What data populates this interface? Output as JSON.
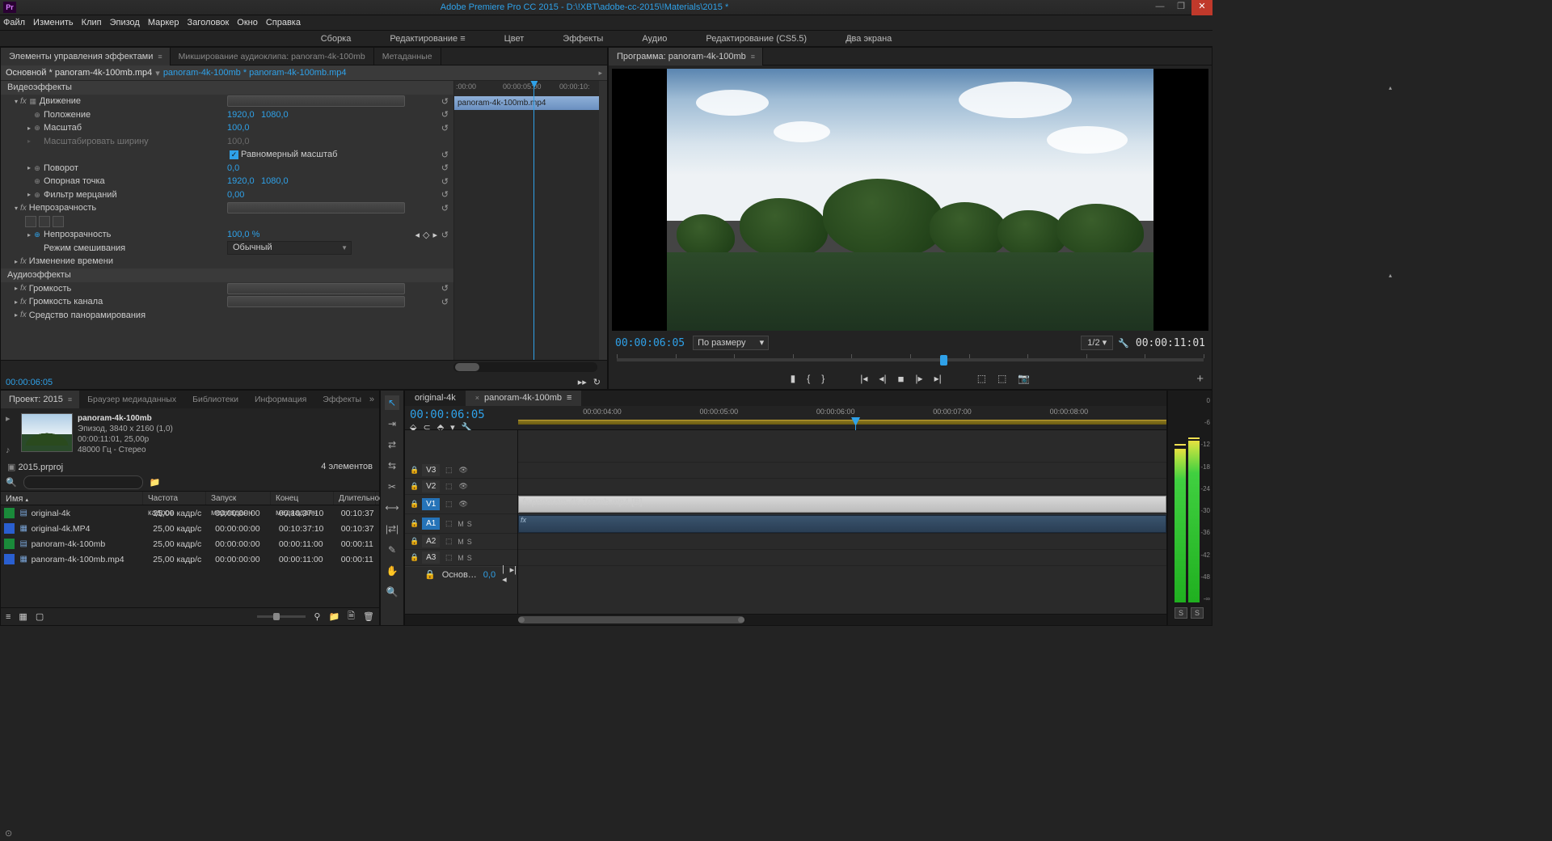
{
  "app": {
    "title": "Adobe Premiere Pro CC 2015 - D:\\!XBT\\adobe-cc-2015\\!Materials\\2015 *"
  },
  "menu": [
    "Файл",
    "Изменить",
    "Клип",
    "Эпизод",
    "Маркер",
    "Заголовок",
    "Окно",
    "Справка"
  ],
  "workspaces": {
    "items": [
      "Сборка",
      "Редактирование",
      "Цвет",
      "Эффекты",
      "Аудио",
      "Редактирование (CS5.5)",
      "Два экрана"
    ],
    "active": 1
  },
  "effectControls": {
    "tabs": [
      "Элементы управления эффектами",
      "Микширование аудиоклипа: panoram-4k-100mb",
      "Метаданные"
    ],
    "activeTab": 0,
    "source": {
      "primary": "Основной * panoram-4k-100mb.mp4",
      "link1": "panoram-4k-100mb",
      "link2": "panoram-4k-100mb.mp4"
    },
    "sections": {
      "videoHeader": "Видеоэффекты",
      "motion": "Движение",
      "position": {
        "label": "Положение",
        "x": "1920,0",
        "y": "1080,0"
      },
      "scale": {
        "label": "Масштаб",
        "val": "100,0"
      },
      "scaleWidth": {
        "label": "Масштабировать ширину",
        "val": "100,0"
      },
      "uniform": {
        "label": "Равномерный масштаб"
      },
      "rotation": {
        "label": "Поворот",
        "val": "0,0"
      },
      "anchor": {
        "label": "Опорная точка",
        "x": "1920,0",
        "y": "1080,0"
      },
      "flicker": {
        "label": "Фильтр мерцаний",
        "val": "0,00"
      },
      "opacity": "Непрозрачность",
      "opacityVal": {
        "label": "Непрозрачность",
        "val": "100,0 %"
      },
      "blend": {
        "label": "Режим смешивания",
        "val": "Обычный"
      },
      "timeRemap": "Изменение времени",
      "audioHeader": "Аудиоэффекты",
      "volume": "Громкость",
      "channelVolume": "Громкость канала",
      "panner": "Средство панорамирования"
    },
    "miniTimeline": {
      "ticks": [
        ":00:00",
        "00:00:05:00",
        "00:00:10:"
      ],
      "clipLabel": "panoram-4k-100mb.mp4",
      "playheadPct": 55
    },
    "footerTC": "00:00:06:05"
  },
  "program": {
    "title": "Программа: panoram-4k-100mb",
    "tcLeft": "00:00:06:05",
    "zoom": "По размеру кадра",
    "half": "1/2",
    "tcRight": "00:00:11:01",
    "playheadPct": 55
  },
  "project": {
    "tabs": [
      "Проект: 2015",
      "Браузер медиаданных",
      "Библиотеки",
      "Информация",
      "Эффекты"
    ],
    "activeTab": 0,
    "clip": {
      "name": "panoram-4k-100mb",
      "line1": "Эпизод, 3840 x 2160 (1,0)",
      "line2": "00:00:11:01, 25,00p",
      "line3": "48000 Гц - Стерео"
    },
    "path": "2015.prproj",
    "count": "4 элементов",
    "searchPlaceholder": "",
    "columns": [
      "Имя",
      "Частота кадров",
      "Запуск медиаданн",
      "Конец медиаданн",
      "Длительнос"
    ],
    "rows": [
      {
        "color": "green",
        "icon": "seq",
        "name": "original-4k",
        "fr": "25,00 кадр/с",
        "st": "00:00:00:00",
        "en": "00:10:37:10",
        "du": "00:10:37"
      },
      {
        "color": "blue",
        "icon": "clip",
        "name": "original-4k.MP4",
        "fr": "25,00 кадр/с",
        "st": "00:00:00:00",
        "en": "00:10:37:10",
        "du": "00:10:37"
      },
      {
        "color": "green",
        "icon": "seq",
        "name": "panoram-4k-100mb",
        "fr": "25,00 кадр/с",
        "st": "00:00:00:00",
        "en": "00:00:11:00",
        "du": "00:00:11"
      },
      {
        "color": "blue",
        "icon": "clip",
        "name": "panoram-4k-100mb.mp4",
        "fr": "25,00 кадр/с",
        "st": "00:00:00:00",
        "en": "00:00:11:00",
        "du": "00:00:11"
      }
    ]
  },
  "timeline": {
    "tabs": [
      {
        "name": "original-4k",
        "active": false
      },
      {
        "name": "panoram-4k-100mb",
        "active": true
      }
    ],
    "tc": "00:00:06:05",
    "ruler": [
      "00:00:04:00",
      "00:00:05:00",
      "00:00:06:00",
      "00:00:07:00",
      "00:00:08:00"
    ],
    "tracks": {
      "v3": "V3",
      "v2": "V2",
      "v1": "V1",
      "a1": "A1",
      "a2": "A2",
      "a3": "A3",
      "master": "Основ…",
      "masterVal": "0,0"
    },
    "clipV": "panoram-4k-100mb.mp4 [В]",
    "playheadPct": 52
  },
  "audioScale": [
    "0",
    "-6",
    "-12",
    "-18",
    "-24",
    "-30",
    "-36",
    "-42",
    "-48",
    "-∞"
  ],
  "status": "⊙"
}
